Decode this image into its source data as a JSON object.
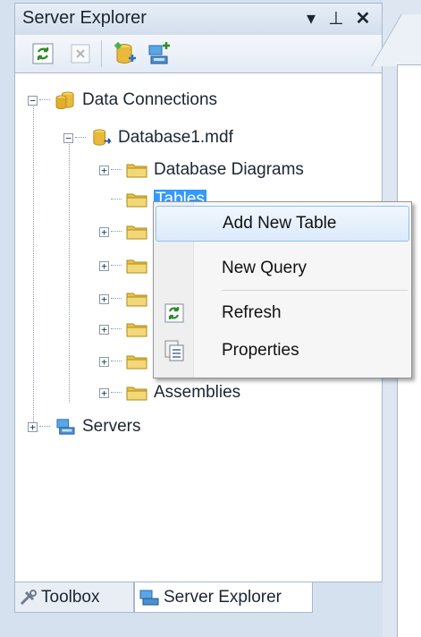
{
  "panel": {
    "title": "Server Explorer",
    "title_buttons": {
      "dropdown": "▾",
      "pin": "⊥",
      "close": "✕"
    }
  },
  "toolbar": {
    "icons": [
      "refresh-icon",
      "stop-icon",
      "connect-to-database-icon",
      "connect-to-server-icon"
    ]
  },
  "tree": {
    "data_connections": "Data Connections",
    "database": "Database1.mdf",
    "database_diagrams": "Database Diagrams",
    "tables": "Tables",
    "assemblies": "Assemblies",
    "servers": "Servers",
    "expander_collapsed": "+",
    "expander_expanded": "−"
  },
  "context_menu": {
    "items": [
      {
        "label": "Add New Table",
        "icon": ""
      },
      {
        "label": "New Query",
        "icon": ""
      },
      {
        "label": "Refresh",
        "icon": "refresh-icon"
      },
      {
        "label": "Properties",
        "icon": "properties-icon"
      }
    ]
  },
  "tabs": {
    "toolbox": "Toolbox",
    "server_explorer": "Server Explorer"
  },
  "colors": {
    "selection": "#3399ff",
    "menu_highlight_border": "#8ec1ec",
    "folder": "#e8c24a"
  }
}
